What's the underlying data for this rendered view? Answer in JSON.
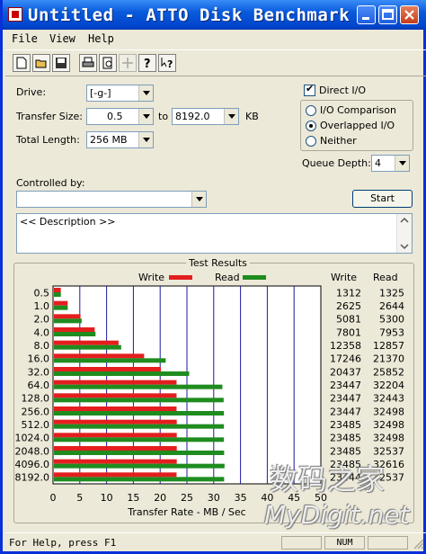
{
  "window": {
    "title": "Untitled - ATTO Disk Benchmark"
  },
  "menu": [
    "File",
    "View",
    "Help"
  ],
  "toolbar_icons": [
    "new-icon",
    "open-icon",
    "save-icon",
    "print-icon",
    "print-preview-icon",
    "move-icon",
    "help-icon",
    "context-help-icon"
  ],
  "settings": {
    "drive_label": "Drive:",
    "drive_value": "[-g-]",
    "transfer_size_label": "Transfer Size:",
    "transfer_from": "0.5",
    "to_label": "to",
    "transfer_to": "8192.0",
    "kb_label": "KB",
    "total_length_label": "Total Length:",
    "total_length": "256 MB",
    "direct_io_label": "Direct I/O",
    "direct_io_checked": true,
    "io_comparison_label": "I/O Comparison",
    "overlapped_io_label": "Overlapped I/O",
    "neither_label": "Neither",
    "selected_io_mode": "Overlapped I/O",
    "queue_depth_label": "Queue Depth:",
    "queue_depth": "4",
    "controlled_by_label": "Controlled by:",
    "controlled_by": "",
    "start_label": "Start",
    "description": "<< Description >>"
  },
  "results": {
    "title": "Test Results",
    "write_legend": "Write",
    "read_legend": "Read",
    "write_header": "Write",
    "read_header": "Read"
  },
  "chart_data": {
    "type": "bar",
    "orientation": "horizontal",
    "title": "Test Results",
    "xlabel": "Transfer Rate - MB / Sec",
    "xlim": [
      0,
      50
    ],
    "xticks": [
      "0",
      "5",
      "10",
      "15",
      "20",
      "25",
      "30",
      "35",
      "40",
      "45",
      "50"
    ],
    "categories": [
      "0.5",
      "1.0",
      "2.0",
      "4.0",
      "8.0",
      "16.0",
      "32.0",
      "64.0",
      "128.0",
      "256.0",
      "512.0",
      "1024.0",
      "2048.0",
      "4096.0",
      "8192.0"
    ],
    "series": [
      {
        "name": "Write",
        "color": "#e41e1e",
        "values": [
          1312,
          2625,
          5081,
          7801,
          12358,
          17246,
          20437,
          23447,
          23447,
          23447,
          23485,
          23485,
          23485,
          23485,
          23444
        ]
      },
      {
        "name": "Read",
        "color": "#1f8c1f",
        "values": [
          1325,
          2644,
          5300,
          7953,
          12857,
          21370,
          25852,
          32204,
          32443,
          32498,
          32498,
          32498,
          32537,
          32616,
          32537
        ]
      }
    ],
    "value_units": "KB/s",
    "grid": true,
    "legend": "top"
  },
  "status": {
    "help_text": "For Help, press F1",
    "num": "NUM"
  },
  "watermark": {
    "line1": "数码之家",
    "line2": "MyDigit.net"
  }
}
